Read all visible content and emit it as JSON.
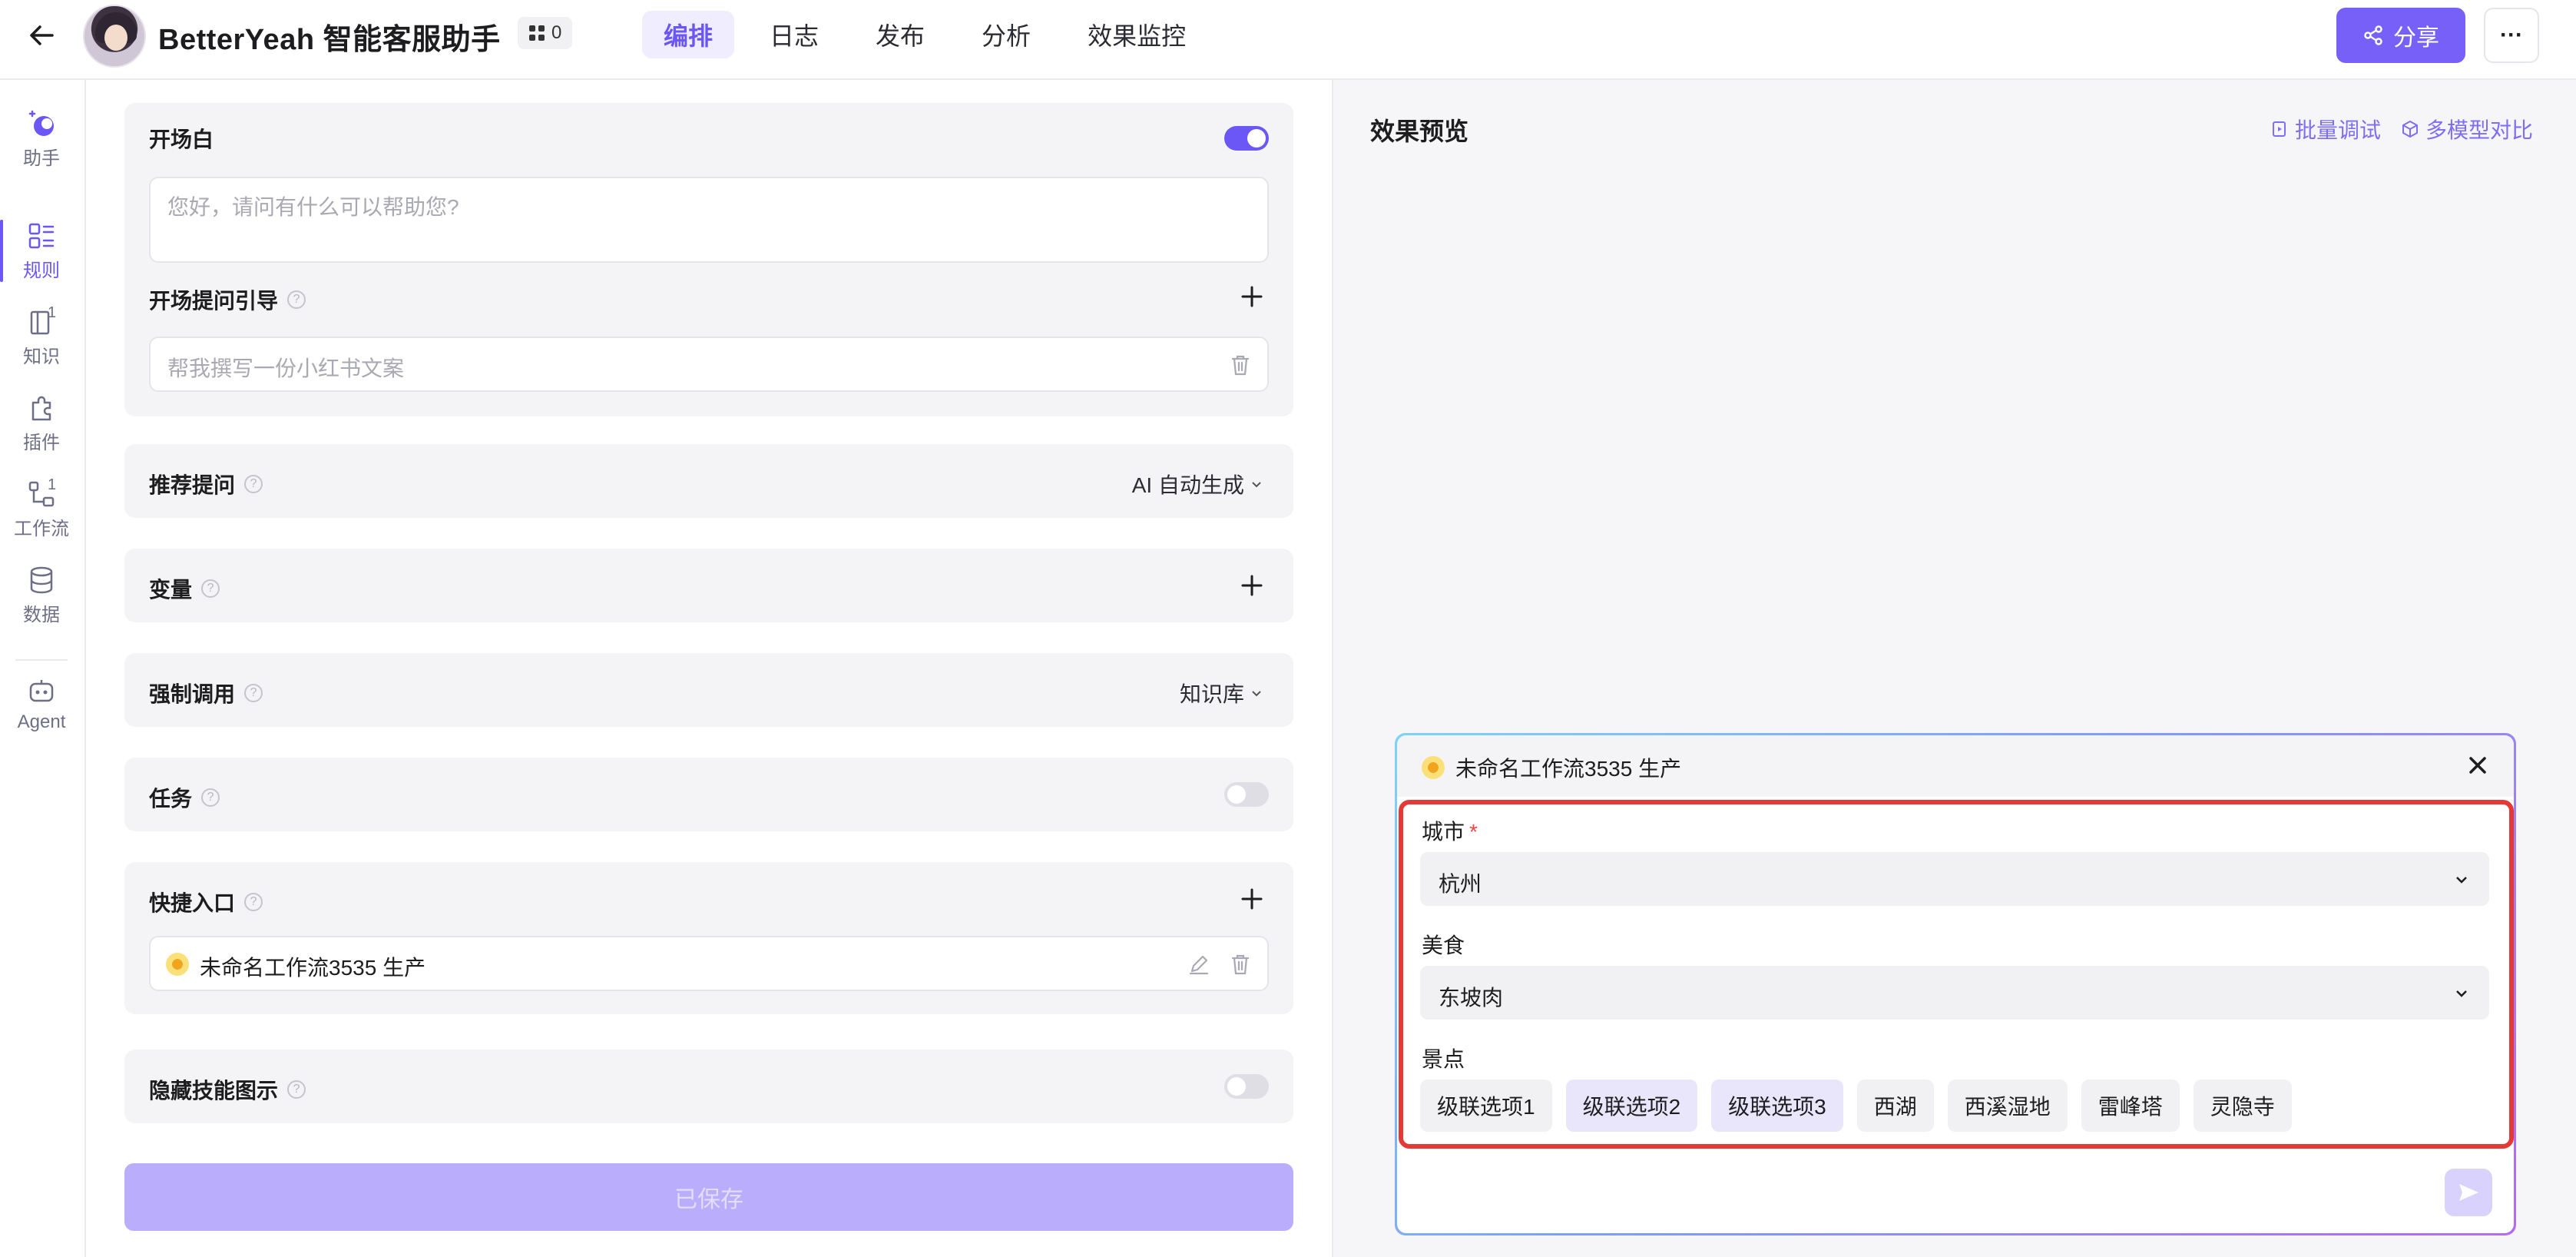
{
  "header": {
    "app_title": "BetterYeah 智能客服助手",
    "badge_count": "0",
    "tabs": [
      {
        "label": "编排",
        "active": true
      },
      {
        "label": "日志"
      },
      {
        "label": "发布"
      },
      {
        "label": "分析"
      },
      {
        "label": "效果监控"
      }
    ],
    "share_label": "分享",
    "more_label": "···",
    "accent_color": "#7660f8"
  },
  "rail": {
    "items": [
      {
        "label": "助手",
        "icon": "assistant-icon"
      },
      {
        "label": "规则",
        "icon": "rules-icon",
        "active": true
      },
      {
        "label": "知识",
        "icon": "knowledge-icon",
        "sub": "1"
      },
      {
        "label": "插件",
        "icon": "plugin-icon"
      },
      {
        "label": "工作流",
        "icon": "workflow-icon",
        "sub": "1"
      },
      {
        "label": "数据",
        "icon": "database-icon"
      },
      {
        "label": "Agent",
        "icon": "agent-icon"
      }
    ]
  },
  "config": {
    "opening": {
      "title": "开场白",
      "enabled": true,
      "placeholder": "您好，请问有什么可以帮助您?"
    },
    "opening_guide": {
      "title": "开场提问引导",
      "placeholder": "帮我撰写一份小红书文案"
    },
    "recommend": {
      "title": "推荐提问",
      "value": "AI 自动生成"
    },
    "variables": {
      "title": "变量"
    },
    "force_call": {
      "title": "强制调用",
      "value": "知识库"
    },
    "tasks": {
      "title": "任务",
      "enabled": false
    },
    "shortcut": {
      "title": "快捷入口",
      "item": "未命名工作流3535 生产"
    },
    "hide_skill": {
      "title": "隐藏技能图示",
      "enabled": false
    },
    "save_label": "已保存"
  },
  "preview": {
    "title": "效果预览",
    "batch_debug": "批量调试",
    "multi_model": "多模型对比",
    "workflow_card": {
      "title": "未命名工作流3535 生产",
      "fields": {
        "city": {
          "label": "城市",
          "required": "*",
          "value": "杭州"
        },
        "food": {
          "label": "美食",
          "value": "东坡肉"
        },
        "spots": {
          "label": "景点",
          "options": [
            {
              "label": "级联选项1",
              "selected": false
            },
            {
              "label": "级联选项2",
              "selected": true
            },
            {
              "label": "级联选项3",
              "selected": true
            },
            {
              "label": "西湖",
              "selected": false
            },
            {
              "label": "西溪湿地",
              "selected": false
            },
            {
              "label": "雷峰塔",
              "selected": false
            },
            {
              "label": "灵隐寺",
              "selected": false
            }
          ]
        }
      },
      "highlight_color": "#e53935"
    }
  }
}
